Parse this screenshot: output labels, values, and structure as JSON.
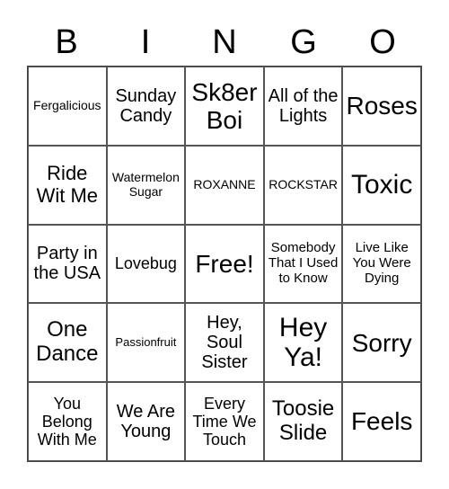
{
  "header": [
    "B",
    "I",
    "N",
    "G",
    "O"
  ],
  "cells": [
    {
      "text": "Fergalicious",
      "size": "s14"
    },
    {
      "text": "Sunday Candy",
      "size": "s20"
    },
    {
      "text": "Sk8er Boi",
      "size": "s28"
    },
    {
      "text": "All of the Lights",
      "size": "s20"
    },
    {
      "text": "Roses",
      "size": "s28"
    },
    {
      "text": "Ride Wit Me",
      "size": "s22"
    },
    {
      "text": "Watermelon Sugar",
      "size": "s14"
    },
    {
      "text": "ROXANNE",
      "size": "s14"
    },
    {
      "text": "ROCKSTAR",
      "size": "s14"
    },
    {
      "text": "Toxic",
      "size": "s30"
    },
    {
      "text": "Party in the USA",
      "size": "s20"
    },
    {
      "text": "Lovebug",
      "size": "s18"
    },
    {
      "text": "Free!",
      "size": "s28"
    },
    {
      "text": "Somebody That I Used to Know",
      "size": "s15"
    },
    {
      "text": "Live Like You Were Dying",
      "size": "s15"
    },
    {
      "text": "One Dance",
      "size": "s24"
    },
    {
      "text": "Passionfruit",
      "size": "s13"
    },
    {
      "text": "Hey, Soul Sister",
      "size": "s20"
    },
    {
      "text": "Hey Ya!",
      "size": "s30"
    },
    {
      "text": "Sorry",
      "size": "s28"
    },
    {
      "text": "You Belong With Me",
      "size": "s18"
    },
    {
      "text": "We Are Young",
      "size": "s20"
    },
    {
      "text": "Every Time We Touch",
      "size": "s18"
    },
    {
      "text": "Toosie Slide",
      "size": "s24"
    },
    {
      "text": "Feels",
      "size": "s28"
    }
  ]
}
